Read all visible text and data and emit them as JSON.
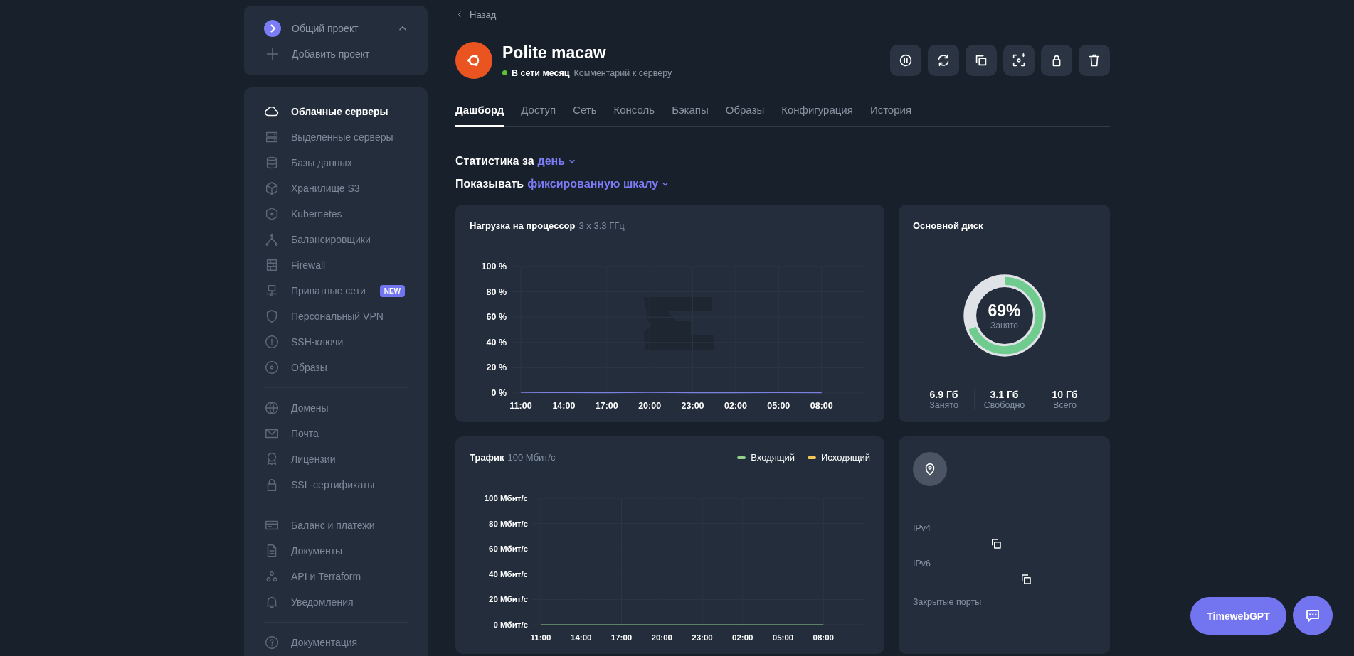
{
  "back_link": "Назад",
  "server": {
    "name": "Polite macaw",
    "online": true,
    "status": "В сети месяц",
    "comment": "Комментарий к серверу"
  },
  "sidebar": {
    "project": {
      "name": "Общий проект",
      "expanded": true,
      "add_label": "Добавить проект"
    },
    "groups": [
      {
        "items": [
          {
            "label": "Облачные серверы",
            "selected": true
          },
          {
            "label": "Выделенные серверы",
            "selected": false
          },
          {
            "label": "Базы данных",
            "selected": false
          },
          {
            "label": "Хранилище S3",
            "selected": false
          },
          {
            "label": "Kubernetes",
            "selected": false
          },
          {
            "label": "Балансировщики",
            "selected": false
          },
          {
            "label": "Firewall",
            "selected": false
          },
          {
            "label": "Приватные сети",
            "selected": false,
            "badge": "NEW"
          },
          {
            "label": "Персональный VPN",
            "selected": false
          },
          {
            "label": "SSH-ключи",
            "selected": false
          },
          {
            "label": "Образы",
            "selected": false
          }
        ]
      },
      {
        "items": [
          {
            "label": "Домены",
            "selected": false
          },
          {
            "label": "Почта",
            "selected": false
          },
          {
            "label": "Лицензии",
            "selected": false
          },
          {
            "label": "SSL-сертификаты",
            "selected": false
          }
        ]
      },
      {
        "items": [
          {
            "label": "Баланс и платежи",
            "selected": false
          },
          {
            "label": "Документы",
            "selected": false
          },
          {
            "label": "API и Terraform",
            "selected": false
          },
          {
            "label": "Уведомления",
            "selected": false
          }
        ]
      },
      {
        "items": [
          {
            "label": "Документация",
            "selected": false
          }
        ]
      }
    ]
  },
  "tabs": [
    {
      "label": "Дашборд",
      "selected": true
    },
    {
      "label": "Доступ",
      "selected": false
    },
    {
      "label": "Сеть",
      "selected": false
    },
    {
      "label": "Консоль",
      "selected": false
    },
    {
      "label": "Бэкапы",
      "selected": false
    },
    {
      "label": "Образы",
      "selected": false
    },
    {
      "label": "Конфигурация",
      "selected": false
    },
    {
      "label": "История",
      "selected": false
    }
  ],
  "stats": {
    "period_label": "Статистика за",
    "period": "день",
    "scale_label": "Показывать",
    "scale": "фиксированную шкалу"
  },
  "cpu": {
    "title": "Нагрузка на процессор",
    "spec": "3 x 3.3 ГГц",
    "chart_data": {
      "type": "line",
      "categories": [
        "11:00",
        "14:00",
        "17:00",
        "20:00",
        "23:00",
        "02:00",
        "05:00",
        "08:00"
      ],
      "series": [
        {
          "color": "#7b7fe0",
          "values": [
            0.5,
            0.4,
            0.3,
            0.5,
            0.3,
            0.3,
            0.4,
            0.3
          ]
        }
      ],
      "ylim": [
        0,
        100
      ],
      "grid": true,
      "yticks": [
        {
          "value": 0,
          "label": "0 %"
        },
        {
          "value": 20,
          "label": "20 %"
        },
        {
          "value": 40,
          "label": "40 %"
        },
        {
          "value": 60,
          "label": "60 %"
        },
        {
          "value": 80,
          "label": "80 %"
        },
        {
          "value": 100,
          "label": "100 %"
        }
      ]
    }
  },
  "traffic": {
    "title": "Трафик",
    "spec": "100 Мбит/с",
    "chart_data": {
      "type": "line",
      "categories": [
        "11:00",
        "14:00",
        "17:00",
        "20:00",
        "23:00",
        "02:00",
        "05:00",
        "08:00"
      ],
      "series": [
        {
          "name": "Входящий",
          "color": "#93d08a",
          "values": [
            0,
            0,
            0,
            0,
            0,
            0,
            0,
            0
          ]
        },
        {
          "name": "Исходящий",
          "color": "#f2c45a",
          "values": [
            null,
            null,
            null,
            null,
            null,
            null,
            null,
            null
          ]
        }
      ],
      "ylim": [
        0,
        100
      ],
      "grid": true,
      "yticks": [
        {
          "value": 0,
          "label": "0 Мбит/с"
        },
        {
          "value": 20,
          "label": "20 Мбит/с"
        },
        {
          "value": 40,
          "label": "40 Мбит/с"
        },
        {
          "value": 60,
          "label": "60 Мбит/с"
        },
        {
          "value": 80,
          "label": "80 Мбит/с"
        },
        {
          "value": 100,
          "label": "100 Мбит/с"
        }
      ]
    }
  },
  "disk": {
    "title": "Основной диск",
    "level": 0.69,
    "percent": "69%",
    "percent_label": "Занято",
    "stats": [
      {
        "value": "6.9 Гб",
        "label": "Занято"
      },
      {
        "value": "3.1 Гб",
        "label": "Свободно"
      },
      {
        "value": "10 Гб",
        "label": "Всего"
      }
    ]
  },
  "network": {
    "ipv4_label": "IPv4",
    "ipv6_label": "IPv6",
    "ports_label": "Закрытые порты"
  },
  "assistant": {
    "label": "TimewebGPT"
  }
}
